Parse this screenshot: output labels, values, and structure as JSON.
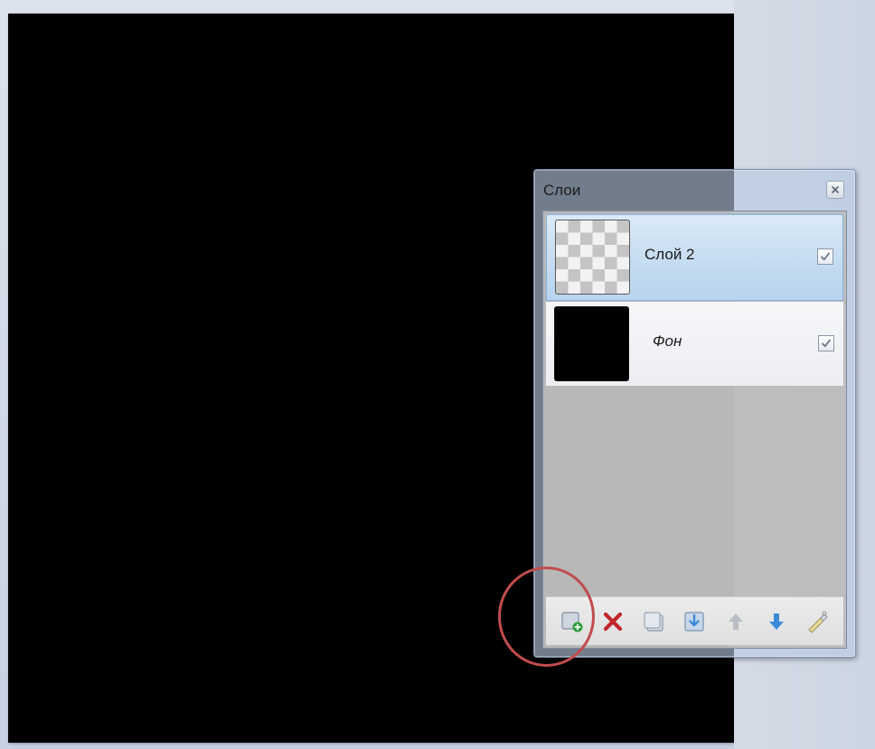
{
  "layers_panel": {
    "title": "Слои",
    "layers": [
      {
        "name": "Слой 2",
        "visible": true,
        "selected": true,
        "thumbnail": "transparent"
      },
      {
        "name": "Фон",
        "visible": true,
        "selected": false,
        "thumbnail": "black"
      }
    ],
    "toolbar": [
      {
        "action": "add-layer",
        "icon": "add-layer-icon"
      },
      {
        "action": "delete-layer",
        "icon": "delete-x-icon"
      },
      {
        "action": "duplicate-layer",
        "icon": "duplicate-layer-icon"
      },
      {
        "action": "merge-layer-down",
        "icon": "merge-down-icon"
      },
      {
        "action": "move-layer-up",
        "icon": "arrow-up-icon"
      },
      {
        "action": "move-layer-down",
        "icon": "arrow-down-icon"
      },
      {
        "action": "layer-properties",
        "icon": "layer-properties-icon"
      }
    ]
  },
  "colors": {
    "canvas": "#000000",
    "selection_blue": "#c5dcf1",
    "highlight_circle": "#c14c4c",
    "delete_red": "#c0262c",
    "arrow_blue": "#3c8ad8",
    "add_green": "#2e9e3a"
  }
}
